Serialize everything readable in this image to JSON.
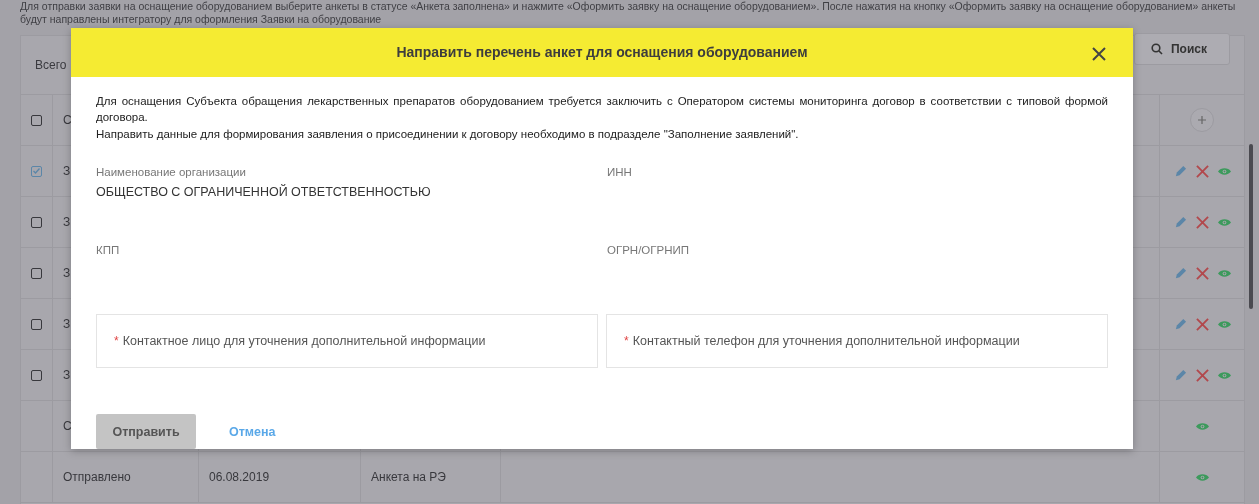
{
  "notice": [
    "Для отправки заявки на оснащение оборудованием выберите анкеты в статусе «Анкета заполнена» и нажмите «Оформить заявку на оснащение оборудованием». После нажатия на кнопку «Оформить заявку на оснащение оборудованием» анкеты",
    "будут направлены интегратору для оформления Заявки на оборудование"
  ],
  "search_button": "Поиск",
  "table": {
    "summary": "Всего",
    "header": {
      "checked": false,
      "column_1": "С"
    },
    "rows": [
      {
        "kind": "selectable",
        "checked": true,
        "column_1": "З",
        "editable": true
      },
      {
        "kind": "selectable",
        "checked": false,
        "column_1": "З",
        "editable": true
      },
      {
        "kind": "selectable",
        "checked": false,
        "column_1": "З",
        "editable": true
      },
      {
        "kind": "selectable",
        "checked": false,
        "column_1": "З",
        "editable": true
      },
      {
        "kind": "selectable",
        "checked": false,
        "column_1": "З",
        "editable": true
      },
      {
        "kind": "plain",
        "column_1": "С",
        "editable": false
      },
      {
        "kind": "plain",
        "column_1": "Отправлено",
        "column_2": "06.08.2019",
        "column_3": "Анкета на РЭ",
        "editable": false
      }
    ]
  },
  "modal": {
    "title": "Направить перечень анкет для оснащения оборудованием",
    "description": [
      "Для оснащения Субъекта обращения лекарственных препаратов оборудованием требуется заключить с Оператором системы мониторинга договор в соответствии с типовой формой договора.",
      "Направить данные для формирования заявления о присоединении к договору необходимо в подразделе \"Заполнение заявлений\"."
    ],
    "fields": [
      {
        "label": "Наименование организации",
        "value": "ОБЩЕСТВО С ОГРАНИЧЕННОЙ ОТВЕТСТВЕННОСТЬЮ"
      },
      {
        "label": "ИНН"
      },
      {
        "label": "КПП"
      },
      {
        "label": "ОГРН/ОГРНИП"
      }
    ],
    "inputs": [
      {
        "required_mark": "*",
        "label": "Контактное лицо для уточнения дополнительной информации"
      },
      {
        "required_mark": "*",
        "label": "Контактный телефон для уточнения дополнительной информации"
      }
    ],
    "submit": {
      "label": "Отправить",
      "disabled": true
    },
    "cancel": "Отмена"
  }
}
